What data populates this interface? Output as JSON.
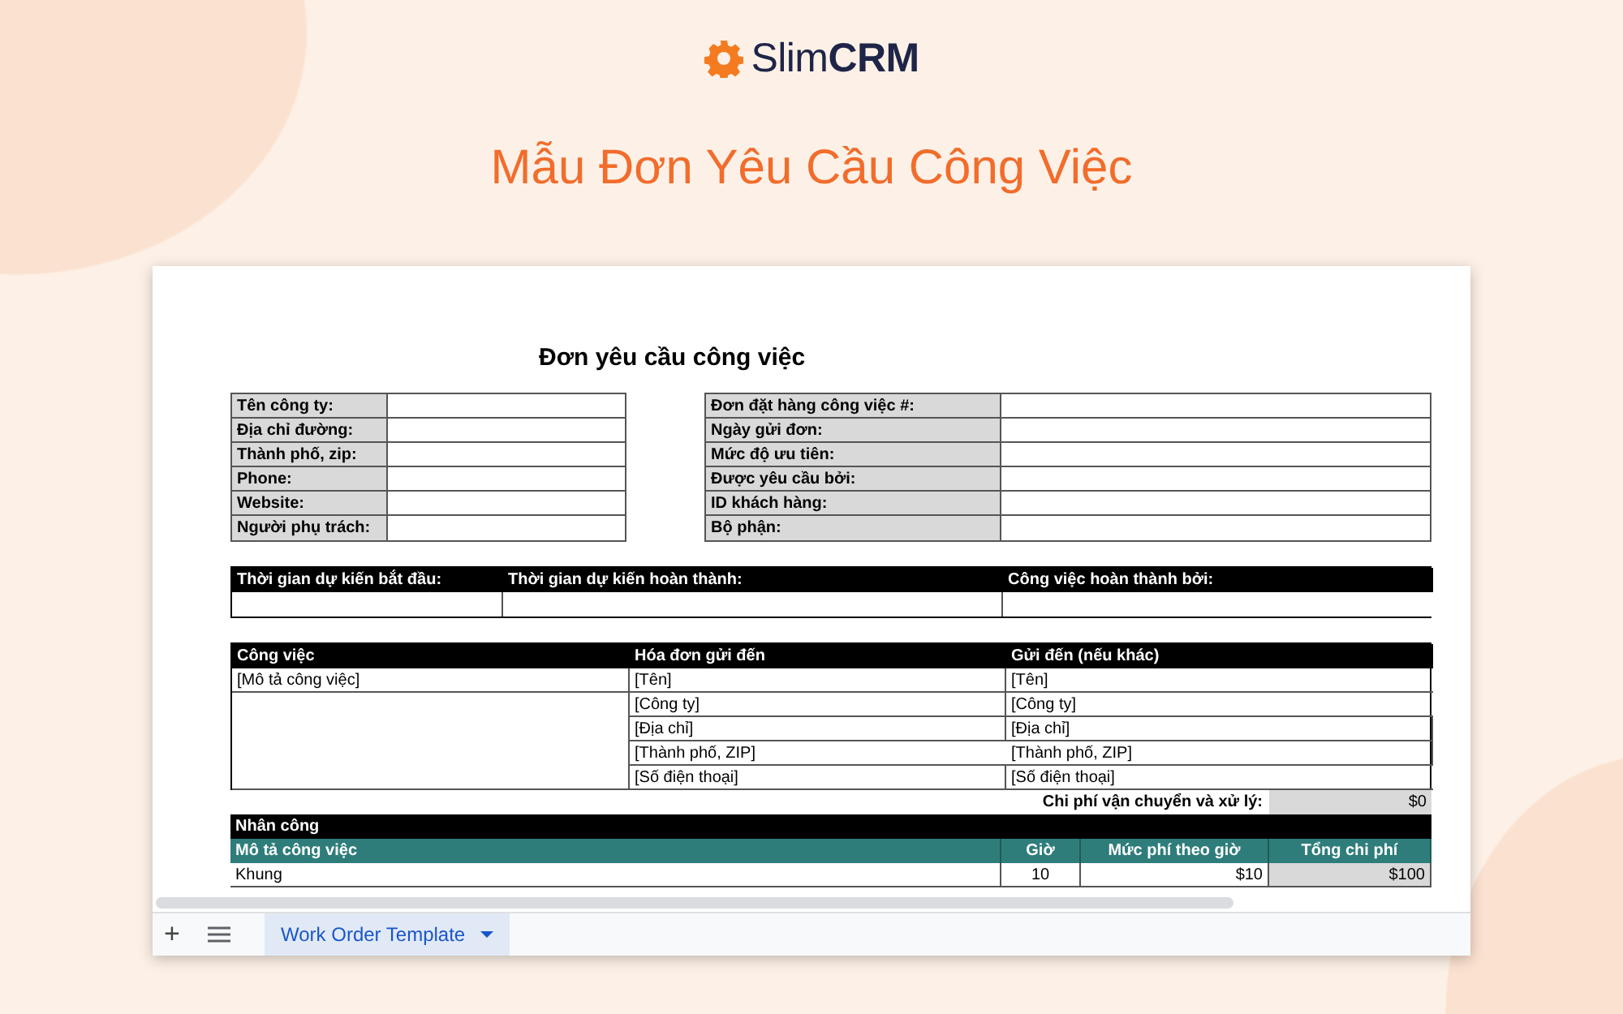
{
  "brand": {
    "name": "Slim**CRM**"
  },
  "heading": "Mẫu Đơn Yêu Cầu Công Việc",
  "sheet": {
    "title": "Đơn yêu cầu công việc",
    "company_fields": [
      {
        "label": "Tên công ty:"
      },
      {
        "label": "Địa chỉ đường:"
      },
      {
        "label": "Thành phố, zip:"
      },
      {
        "label": "Phone:"
      },
      {
        "label": "Website:"
      },
      {
        "label": "Người phụ trách:"
      }
    ],
    "order_fields": [
      {
        "label": "Đơn đặt hàng công việc #:"
      },
      {
        "label": "Ngày gửi đơn:"
      },
      {
        "label": "Mức độ ưu tiên:"
      },
      {
        "label": "Được yêu cầu bởi:"
      },
      {
        "label": "ID khách hàng:"
      },
      {
        "label": "Bộ phận:"
      }
    ],
    "schedule": {
      "columns": [
        "Thời gian dự kiến bắt đầu:",
        "Thời gian dự kiến hoàn thành:",
        "Công việc hoàn thành bởi:"
      ]
    },
    "job": {
      "columns": [
        "Công việc",
        "Hóa đơn gửi đến",
        "Gửi đến (nếu khác)"
      ],
      "description": "[Mô tả công việc]",
      "bill_to": [
        "[Tên]",
        "[Công ty]",
        "[Địa chỉ]",
        "[Thành phố, ZIP]",
        "[Số điện thoại]"
      ],
      "ship_to": [
        "[Tên]",
        "[Công ty]",
        "[Địa chỉ]",
        "[Thành phố, ZIP]",
        "[Số điện thoại]"
      ]
    },
    "shipping": {
      "label": "Chi phí vận chuyển và xử lý:",
      "value": "$0"
    },
    "labor": {
      "title": "Nhân công",
      "columns": [
        "Mô tả công việc",
        "Giờ",
        "Mức phí theo giờ",
        "Tổng chi phí"
      ],
      "rows": [
        {
          "description": "Khung",
          "hours": "10",
          "rate": "$10",
          "total": "$100"
        }
      ]
    }
  },
  "tab_bar": {
    "add": "+",
    "tabs": [
      {
        "label": "Work Order Template",
        "selected": true
      }
    ]
  }
}
